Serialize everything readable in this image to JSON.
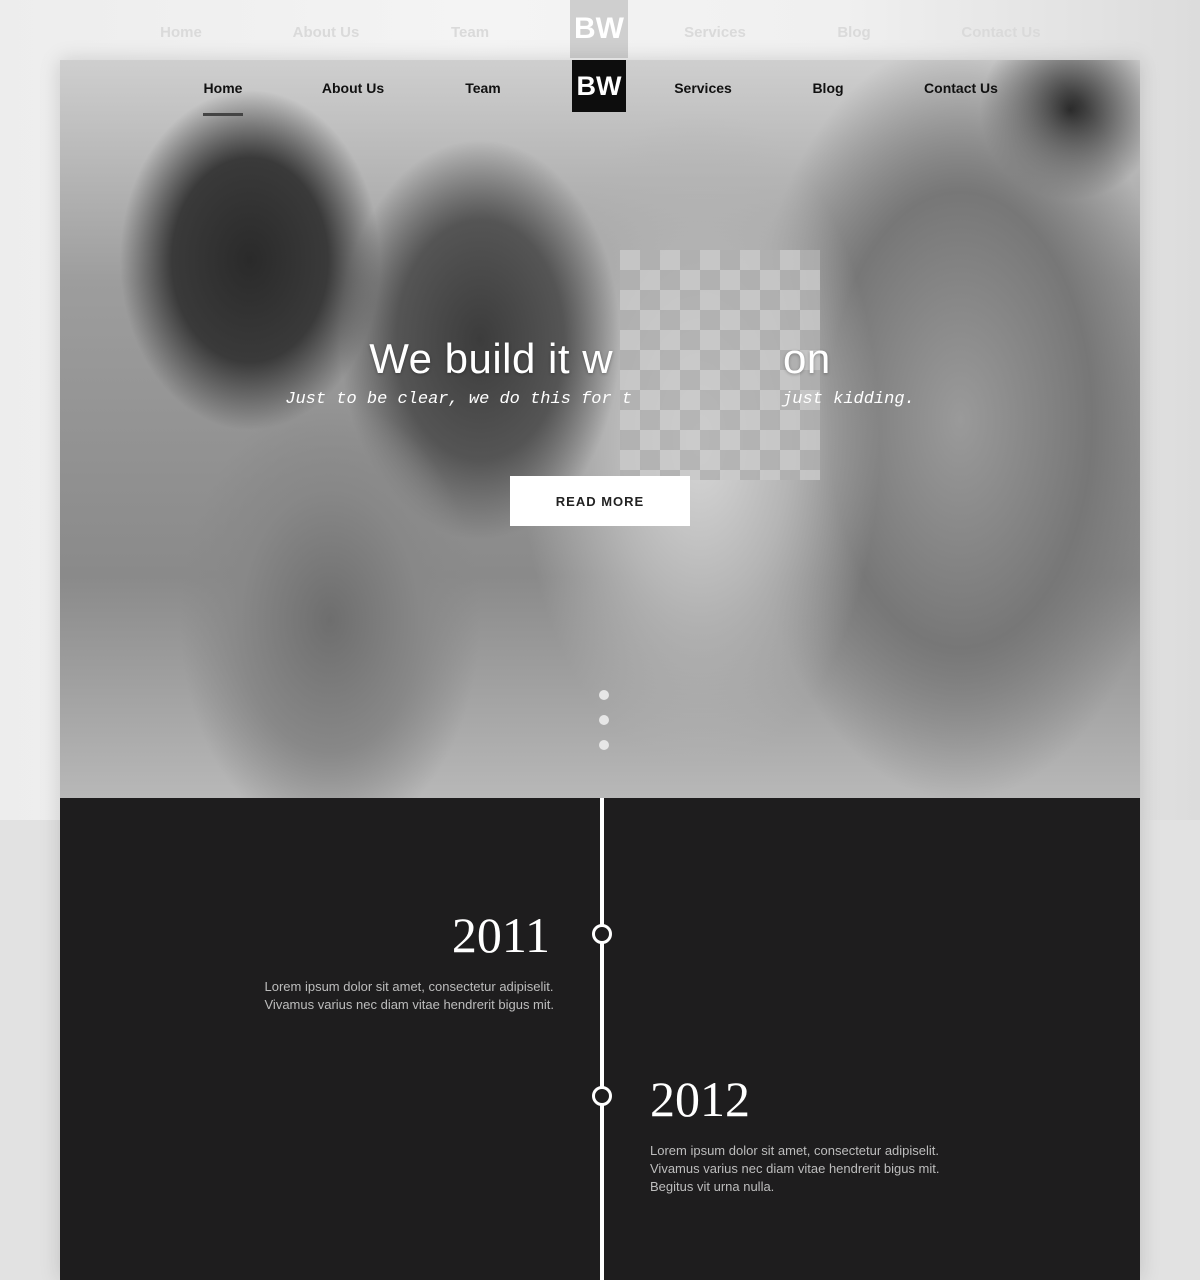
{
  "nav": {
    "items": [
      {
        "label": "Home",
        "active": true
      },
      {
        "label": "About Us"
      },
      {
        "label": "Team"
      },
      {
        "label": "Services"
      },
      {
        "label": "Blog"
      },
      {
        "label": "Contact Us"
      }
    ],
    "logo": "BW"
  },
  "hero": {
    "headline_visible_start": "We build it w",
    "headline_visible_end": "on",
    "subtitle_visible_start": "Just to be clear, we do this for t",
    "subtitle_visible_end": "just kidding.",
    "button_label": "READ MORE",
    "slides": 3
  },
  "timeline": [
    {
      "year": "2011",
      "text": [
        "Lorem ipsum dolor sit amet, consectetur adipiselit.",
        "Vivamus varius nec diam vitae hendrerit bigus mit."
      ]
    },
    {
      "year": "2012",
      "text": [
        "Lorem ipsum dolor sit amet, consectetur adipiselit.",
        "Vivamus varius nec diam vitae hendrerit bigus mit.",
        "Begitus vit urna nulla."
      ]
    }
  ],
  "colors": {
    "dark_section": "#1e1d1e",
    "logo_bg": "#0d0d0d",
    "accent": "#ffffff"
  }
}
